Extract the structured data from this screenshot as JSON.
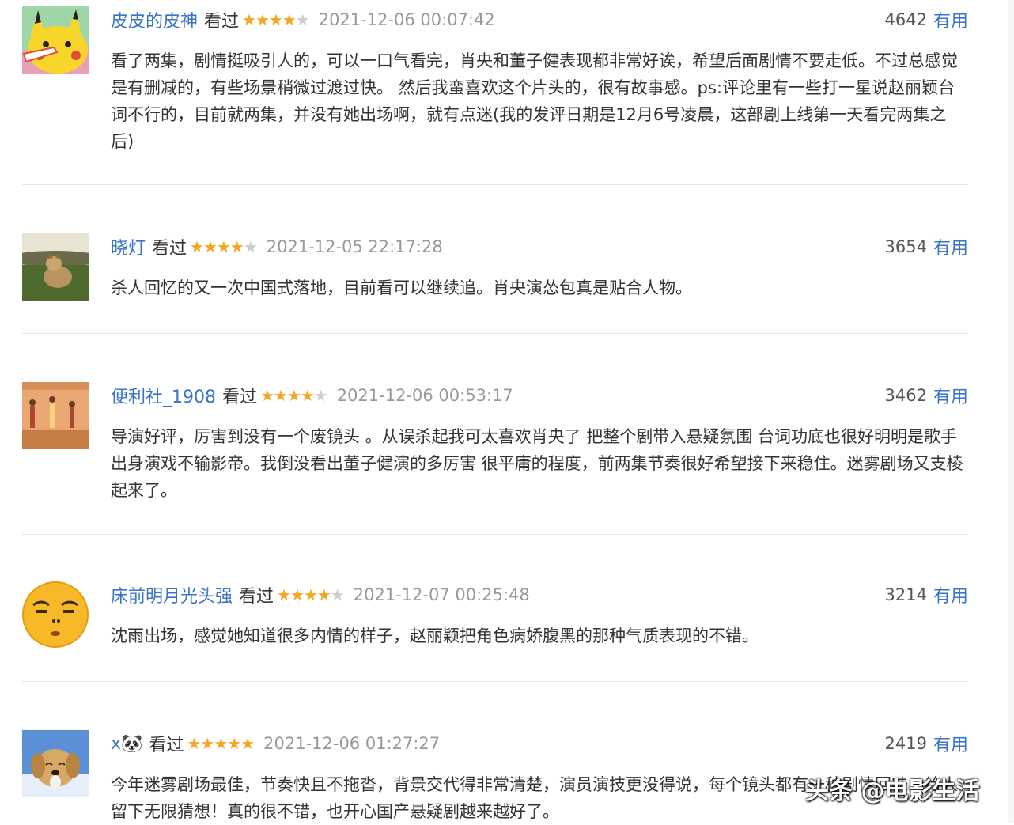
{
  "reviews": [
    {
      "user": "皮皮的皮神",
      "status": "看过",
      "rating": 4,
      "time": "2021-12-06 00:07:42",
      "votes": "4642",
      "useful": "有用",
      "avatar": "pikachu-avatar",
      "content": "看了两集，剧情挺吸引人的，可以一口气看完，肖央和董子健表现都非常好诶，希望后面剧情不要走低。不过总感觉是有删减的，有些场景稍微过渡过快。 然后我蛮喜欢这个片头的，很有故事感。ps:评论里有一些打一星说赵丽颖台词不行的，目前就两集，并没有她出场啊，就有点迷(我的发评日期是12月6号凌晨，这部剧上线第一天看完两集之后)"
    },
    {
      "user": "晓灯",
      "status": "看过",
      "rating": 4,
      "time": "2021-12-05 22:17:28",
      "votes": "3654",
      "useful": "有用",
      "avatar": "dog-field-avatar",
      "content": "杀人回忆的又一次中国式落地，目前看可以继续追。肖央演怂包真是贴合人物。"
    },
    {
      "user": "便利社_1908",
      "status": "看过",
      "rating": 4,
      "time": "2021-12-06 00:53:17",
      "votes": "3462",
      "useful": "有用",
      "avatar": "runners-avatar",
      "content": "导演好评，厉害到没有一个废镜头 。从误杀起我可太喜欢肖央了 把整个剧带入悬疑氛围 台词功底也很好明明是歌手出身演戏不输影帝。我倒没看出董子健演的多厉害 很平庸的程度，前两集节奏很好希望接下来稳住。迷雾剧场又支棱起来了。"
    },
    {
      "user": "床前明月光头强",
      "status": "看过",
      "rating": 4,
      "time": "2021-12-07 00:25:48",
      "votes": "3214",
      "useful": "有用",
      "avatar": "emoji-face-avatar",
      "content": "沈雨出场，感觉她知道很多内情的样子，赵丽颖把角色病娇腹黑的那种气质表现的不错。"
    },
    {
      "user": "x🐼",
      "status": "看过",
      "rating": 5,
      "time": "2021-12-06 01:27:27",
      "votes": "2419",
      "useful": "有用",
      "avatar": "puppy-avatar",
      "content": "今年迷雾剧场最佳，节奏快且不拖沓，背景交代得非常清楚，演员演技更没得说，每个镜头都有一种剧情回味，给人留下无限猜想！真的很不错，也开心国产悬疑剧越来越好了。"
    }
  ],
  "watermark": "头条 @电影生活",
  "colors": {
    "link": "#3a74c9",
    "star": "#f5a623",
    "muted": "#999999"
  }
}
